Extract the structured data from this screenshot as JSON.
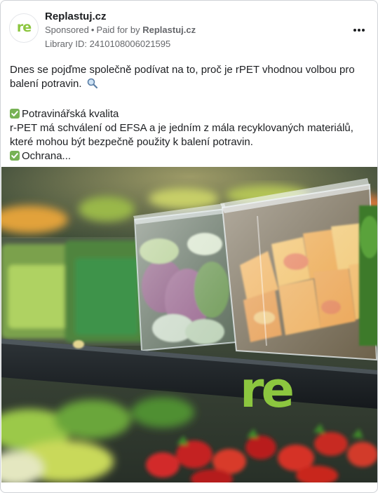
{
  "post": {
    "page_name": "Replastuj.cz",
    "avatar_text": "re",
    "sponsored_label": "Sponsored",
    "paid_prefix": "Paid for by",
    "paid_by": "Replastuj.cz",
    "library_id": "Library ID: 2410108006021595",
    "more_icon": "more-horizontal-icon",
    "text": {
      "intro": "Dnes se pojďme společně podívat na to, proč je rPET vhodnou volbou pro balení potravin.",
      "point1_title": "Potravinářská kvalita",
      "point1_body": "r-PET má schválení od EFSA a je jedním z mála recyklovaných materiálů, které mohou být bezpečně použity k balení potravin.",
      "point2_title": "Ochrana..."
    }
  },
  "media": {
    "logo_text": "re",
    "logo_color": "#8cc63f",
    "description_icon": "supermarket-shelf-image"
  },
  "colors": {
    "text": "#1c1e21",
    "meta": "#65676b",
    "check_green": "#77b255",
    "brand_green": "#8cc63f"
  }
}
